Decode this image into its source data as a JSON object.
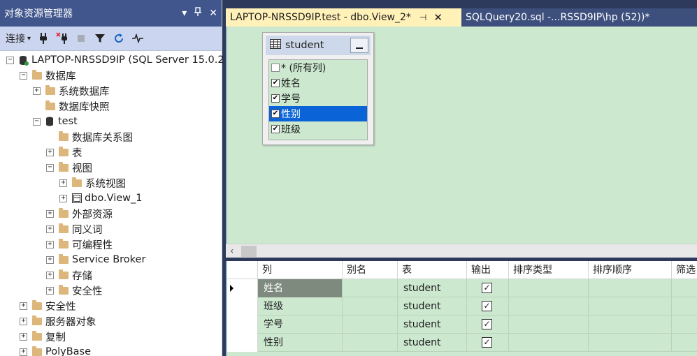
{
  "object_explorer": {
    "title": "对象资源管理器",
    "toolbar": {
      "connect_label": "连接"
    },
    "tree": [
      {
        "label": "LAPTOP-NRSSD9IP (SQL Server 15.0.2",
        "level": 0,
        "expander": "−",
        "icon": "server-icon"
      },
      {
        "label": "数据库",
        "level": 1,
        "expander": "−",
        "icon": "folder-icon"
      },
      {
        "label": "系统数据库",
        "level": 2,
        "expander": "+",
        "icon": "folder-icon"
      },
      {
        "label": "数据库快照",
        "level": 2,
        "expander": "",
        "icon": "folder-icon"
      },
      {
        "label": "test",
        "level": 2,
        "expander": "−",
        "icon": "database-icon"
      },
      {
        "label": "数据库关系图",
        "level": 3,
        "expander": "",
        "icon": "folder-icon"
      },
      {
        "label": "表",
        "level": 3,
        "expander": "+",
        "icon": "folder-icon"
      },
      {
        "label": "视图",
        "level": 3,
        "expander": "−",
        "icon": "folder-icon"
      },
      {
        "label": "系统视图",
        "level": 4,
        "expander": "+",
        "icon": "folder-icon"
      },
      {
        "label": "dbo.View_1",
        "level": 4,
        "expander": "+",
        "icon": "view-icon"
      },
      {
        "label": "外部资源",
        "level": 3,
        "expander": "+",
        "icon": "folder-icon"
      },
      {
        "label": "同义词",
        "level": 3,
        "expander": "+",
        "icon": "folder-icon"
      },
      {
        "label": "可编程性",
        "level": 3,
        "expander": "+",
        "icon": "folder-icon"
      },
      {
        "label": "Service Broker",
        "level": 3,
        "expander": "+",
        "icon": "folder-icon"
      },
      {
        "label": "存储",
        "level": 3,
        "expander": "+",
        "icon": "folder-icon"
      },
      {
        "label": "安全性",
        "level": 3,
        "expander": "+",
        "icon": "folder-icon"
      },
      {
        "label": "安全性",
        "level": 1,
        "expander": "+",
        "icon": "folder-icon"
      },
      {
        "label": "服务器对象",
        "level": 1,
        "expander": "+",
        "icon": "folder-icon"
      },
      {
        "label": "复制",
        "level": 1,
        "expander": "+",
        "icon": "folder-icon"
      },
      {
        "label": "PolyBase",
        "level": 1,
        "expander": "+",
        "icon": "folder-icon"
      }
    ]
  },
  "tabs": {
    "active": "LAPTOP-NRSSD9IP.test - dbo.View_2*",
    "other": "SQLQuery20.sql -...RSSD9IP\\hp (52))*"
  },
  "diagram": {
    "table_name": "student",
    "columns": [
      {
        "label": "* (所有列)",
        "checked": false,
        "selected": false
      },
      {
        "label": "姓名",
        "checked": true,
        "selected": false
      },
      {
        "label": "学号",
        "checked": true,
        "selected": false
      },
      {
        "label": "性别",
        "checked": true,
        "selected": true
      },
      {
        "label": "班级",
        "checked": true,
        "selected": false
      }
    ]
  },
  "grid": {
    "headers": [
      "列",
      "别名",
      "表",
      "输出",
      "排序类型",
      "排序顺序",
      "筛选"
    ],
    "rows": [
      {
        "column": "姓名",
        "alias": "",
        "table": "student",
        "output": true,
        "current": true
      },
      {
        "column": "班级",
        "alias": "",
        "table": "student",
        "output": true,
        "current": false
      },
      {
        "column": "学号",
        "alias": "",
        "table": "student",
        "output": true,
        "current": false
      },
      {
        "column": "性别",
        "alias": "",
        "table": "student",
        "output": true,
        "current": false
      }
    ]
  },
  "colors": {
    "title_bar": "#40568d",
    "toolbar": "#ccd5f0",
    "active_tab": "#fff1b8",
    "designer_bg": "#cce8cf",
    "selection": "#0a64d8"
  }
}
